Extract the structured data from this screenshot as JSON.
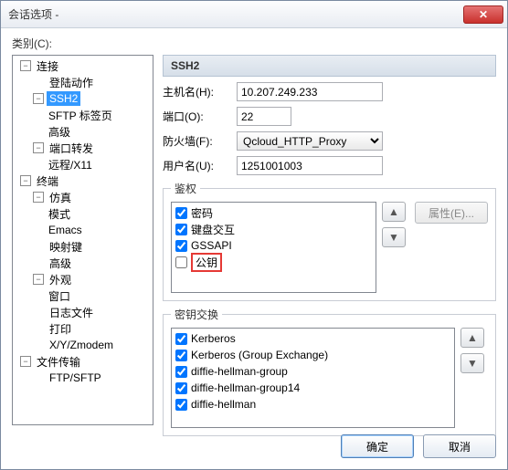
{
  "window": {
    "title": "会话选项 - "
  },
  "category_label": "类别(C):",
  "tree": {
    "n0": "连接",
    "n1": "登陆动作",
    "n2": "SSH2",
    "n3": "SFTP 标签页",
    "n4": "高级",
    "n5": "端口转发",
    "n6": "远程/X11",
    "n7": "终端",
    "n8": "仿真",
    "n9": "模式",
    "n10": "Emacs",
    "n11": "映射键",
    "n12": "高级",
    "n13": "外观",
    "n14": "窗口",
    "n15": "日志文件",
    "n16": "打印",
    "n17": "X/Y/Zmodem",
    "n18": "文件传输",
    "n19": "FTP/SFTP"
  },
  "panel": {
    "title": "SSH2"
  },
  "form": {
    "host_label": "主机名(H):",
    "host_value": "10.207.249.233",
    "port_label": "端口(O):",
    "port_value": "22",
    "firewall_label": "防火墙(F):",
    "firewall_value": "Qcloud_HTTP_Proxy",
    "user_label": "用户名(U):",
    "user_value": "1251001003"
  },
  "auth": {
    "legend": "鉴权",
    "items": [
      "密码",
      "键盘交互",
      "GSSAPI",
      "公钥"
    ],
    "checked": [
      true,
      true,
      true,
      false
    ],
    "attr_btn": "属性(E)..."
  },
  "kex": {
    "legend": "密钥交换",
    "items": [
      "Kerberos",
      "Kerberos (Group Exchange)",
      "diffie-hellman-group",
      "diffie-hellman-group14",
      "diffie-hellman"
    ],
    "checked": [
      true,
      true,
      true,
      true,
      true
    ]
  },
  "buttons": {
    "ok": "确定",
    "cancel": "取消"
  }
}
